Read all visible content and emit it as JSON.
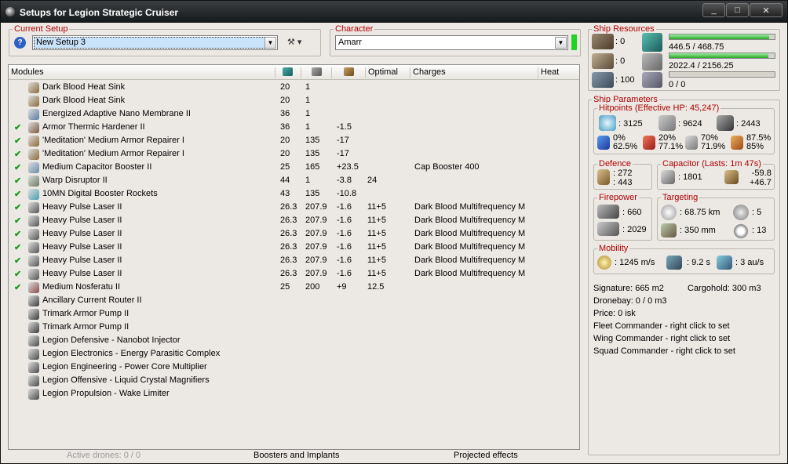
{
  "window": {
    "title": "Setups for Legion Strategic Cruiser",
    "minimize": "_",
    "maximize": "□",
    "close": "✕"
  },
  "setup": {
    "label": "Current Setup",
    "value": "New Setup 3",
    "help": "?",
    "tool": "⚒ ▾"
  },
  "character": {
    "label": "Character",
    "value": "Amarr",
    "status_color": "#21d321"
  },
  "modules": {
    "label": "Modules",
    "columns": {
      "optimal": "Optimal",
      "charges": "Charges",
      "heat": "Heat"
    },
    "rows": [
      {
        "check": "",
        "name": "Dark Blood Heat Sink",
        "c1": "20",
        "c2": "1",
        "c3": "",
        "opt": "",
        "charge": "",
        "icon": "#8a6a3a"
      },
      {
        "check": "",
        "name": "Dark Blood Heat Sink",
        "c1": "20",
        "c2": "1",
        "c3": "",
        "opt": "",
        "charge": "",
        "icon": "#8a6a3a"
      },
      {
        "check": "",
        "name": "Energized Adaptive Nano Membrane II",
        "c1": "36",
        "c2": "1",
        "c3": "",
        "opt": "",
        "charge": "",
        "icon": "#5a7aa0"
      },
      {
        "check": "✔",
        "name": "Armor Thermic Hardener II",
        "c1": "36",
        "c2": "1",
        "c3": "-1.5",
        "opt": "",
        "charge": "",
        "icon": "#7a5a40"
      },
      {
        "check": "✔",
        "name": "'Meditation' Medium Armor Repairer I",
        "c1": "20",
        "c2": "135",
        "c3": "-17",
        "opt": "",
        "charge": "",
        "icon": "#8a6a3a"
      },
      {
        "check": "✔",
        "name": "'Meditation' Medium Armor Repairer I",
        "c1": "20",
        "c2": "135",
        "c3": "-17",
        "opt": "",
        "charge": "",
        "icon": "#8a6a3a"
      },
      {
        "check": "✔",
        "name": "Medium Capacitor Booster II",
        "c1": "25",
        "c2": "165",
        "c3": "+23.5",
        "opt": "",
        "charge": "Cap Booster 400",
        "icon": "#6a8aaa"
      },
      {
        "check": "✔",
        "name": "Warp Disruptor II",
        "c1": "44",
        "c2": "1",
        "c3": "-3.8",
        "opt": "24",
        "charge": "",
        "icon": "#6a7a60"
      },
      {
        "check": "✔",
        "name": "10MN Digital Booster Rockets",
        "c1": "43",
        "c2": "135",
        "c3": "-10.8",
        "opt": "",
        "charge": "",
        "icon": "#4aa0b0"
      },
      {
        "check": "✔",
        "name": "Heavy Pulse Laser II",
        "c1": "26.3",
        "c2": "207.9",
        "c3": "-1.6",
        "opt": "11+5",
        "charge": "Dark Blood Multifrequency M",
        "icon": "#555555"
      },
      {
        "check": "✔",
        "name": "Heavy Pulse Laser II",
        "c1": "26.3",
        "c2": "207.9",
        "c3": "-1.6",
        "opt": "11+5",
        "charge": "Dark Blood Multifrequency M",
        "icon": "#555555"
      },
      {
        "check": "✔",
        "name": "Heavy Pulse Laser II",
        "c1": "26.3",
        "c2": "207.9",
        "c3": "-1.6",
        "opt": "11+5",
        "charge": "Dark Blood Multifrequency M",
        "icon": "#555555"
      },
      {
        "check": "✔",
        "name": "Heavy Pulse Laser II",
        "c1": "26.3",
        "c2": "207.9",
        "c3": "-1.6",
        "opt": "11+5",
        "charge": "Dark Blood Multifrequency M",
        "icon": "#555555"
      },
      {
        "check": "✔",
        "name": "Heavy Pulse Laser II",
        "c1": "26.3",
        "c2": "207.9",
        "c3": "-1.6",
        "opt": "11+5",
        "charge": "Dark Blood Multifrequency M",
        "icon": "#555555"
      },
      {
        "check": "✔",
        "name": "Heavy Pulse Laser II",
        "c1": "26.3",
        "c2": "207.9",
        "c3": "-1.6",
        "opt": "11+5",
        "charge": "Dark Blood Multifrequency M",
        "icon": "#555555"
      },
      {
        "check": "✔",
        "name": "Medium Nosferatu II",
        "c1": "25",
        "c2": "200",
        "c3": "+9",
        "opt": "12.5",
        "charge": "",
        "icon": "#8a4a4a"
      },
      {
        "check": "",
        "name": "Ancillary Current Router II",
        "c1": "",
        "c2": "",
        "c3": "",
        "opt": "",
        "charge": "",
        "icon": "#3a3a3a"
      },
      {
        "check": "",
        "name": "Trimark Armor Pump II",
        "c1": "",
        "c2": "",
        "c3": "",
        "opt": "",
        "charge": "",
        "icon": "#3a3a3a"
      },
      {
        "check": "",
        "name": "Trimark Armor Pump II",
        "c1": "",
        "c2": "",
        "c3": "",
        "opt": "",
        "charge": "",
        "icon": "#3a3a3a"
      },
      {
        "check": "",
        "name": "Legion Defensive - Nanobot Injector",
        "c1": "",
        "c2": "",
        "c3": "",
        "opt": "",
        "charge": "",
        "icon": "#4a4a4a"
      },
      {
        "check": "",
        "name": "Legion Electronics - Energy Parasitic Complex",
        "c1": "",
        "c2": "",
        "c3": "",
        "opt": "",
        "charge": "",
        "icon": "#4a4a4a"
      },
      {
        "check": "",
        "name": "Legion Engineering - Power Core Multiplier",
        "c1": "",
        "c2": "",
        "c3": "",
        "opt": "",
        "charge": "",
        "icon": "#4a4a4a"
      },
      {
        "check": "",
        "name": "Legion Offensive - Liquid Crystal Magnifiers",
        "c1": "",
        "c2": "",
        "c3": "",
        "opt": "",
        "charge": "",
        "icon": "#4a4a4a"
      },
      {
        "check": "",
        "name": "Legion Propulsion - Wake Limiter",
        "c1": "",
        "c2": "",
        "c3": "",
        "opt": "",
        "charge": "",
        "icon": "#4a4a4a"
      }
    ]
  },
  "bottom": {
    "drones": "Active drones: 0 / 0",
    "boosters": "Boosters and Implants",
    "projected": "Projected effects"
  },
  "resources": {
    "label": "Ship Resources",
    "turrets": ": 0",
    "launchers": ": 0",
    "calibration": ": 100",
    "cpu": "446.5 / 468.75",
    "cpu_fill": 0.95,
    "power": "2022.4 / 2156.25",
    "power_fill": 0.94,
    "drone_bw": "0 / 0",
    "drone_fill": 0
  },
  "params": {
    "label": "Ship Parameters",
    "hp": {
      "label": "Hitpoints (Effective HP: 45,247)",
      "shield": ": 3125",
      "armor": ": 9624",
      "hull": ": 2443",
      "em": "0%",
      "em2": "62.5%",
      "th": "20%",
      "th2": "77.1%",
      "ki": "70%",
      "ki2": "71.9%",
      "ex": "87.5%",
      "ex2": "85%"
    },
    "defence": {
      "label": "Defence",
      "a": ": 272",
      "b": ": 443"
    },
    "cap": {
      "label": "Capacitor (Lasts: 1m 47s)",
      "amount": ": 1801",
      "a": "-59.8",
      "b": "+46.7"
    },
    "firepower": {
      "label": "Firepower",
      "a": ": 660",
      "b": ": 2029"
    },
    "targeting": {
      "label": "Targeting",
      "range": ": 68.75 km",
      "targets": ": 5",
      "res": ": 350 mm",
      "sensor": ": 13"
    },
    "mobility": {
      "label": "Mobility",
      "speed": ": 1245 m/s",
      "align": ": 9.2 s",
      "warp": ": 3 au/s"
    },
    "signature": "Signature: 665 m2",
    "cargohold": "Cargohold: 300 m3",
    "dronebay": "Dronebay: 0 / 0 m3",
    "price": "Price: 0 isk",
    "fleet": "Fleet Commander - right click to set",
    "wing": "Wing Commander - right click to set",
    "squad": "Squad Commander - right click to set"
  }
}
